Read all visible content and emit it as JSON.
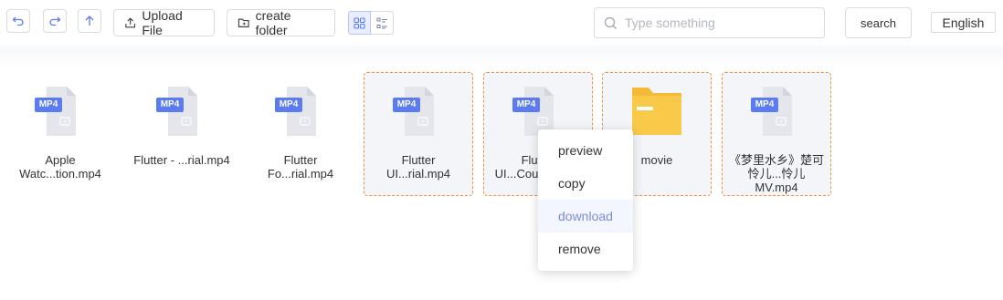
{
  "toolbar": {
    "undo_icon": "undo-icon",
    "redo_icon": "redo-icon",
    "up_icon": "arrow-up-icon",
    "upload_label": "Upload File",
    "create_folder_label": "create folder",
    "search_placeholder": "Type something",
    "search_label": "search",
    "language_label": "English"
  },
  "colors": {
    "accent": "#5b7cf0",
    "selection_border": "#f0903d",
    "mp4_badge": "#5b7cf0",
    "folder": "#f7c443"
  },
  "files": [
    {
      "name": "Apple Watc...tion.mp4",
      "type": "MP4",
      "selected": false
    },
    {
      "name": "Flutter - ...rial.mp4",
      "type": "MP4",
      "selected": false
    },
    {
      "name": "Flutter Fo...rial.mp4",
      "type": "MP4",
      "selected": false
    },
    {
      "name": "Flutter UI...rial.mp4",
      "type": "MP4",
      "selected": true
    },
    {
      "name": "Flutter UI...Course.mp4",
      "type": "MP4",
      "selected": true
    },
    {
      "name": "movie",
      "type": "folder",
      "selected": true
    },
    {
      "name": "《梦里水乡》楚可怜儿...怜儿MV.mp4",
      "type": "MP4",
      "selected": true
    }
  ],
  "context_menu": {
    "items": [
      {
        "label": "preview"
      },
      {
        "label": "copy"
      },
      {
        "label": "download"
      },
      {
        "label": "remove"
      }
    ]
  }
}
